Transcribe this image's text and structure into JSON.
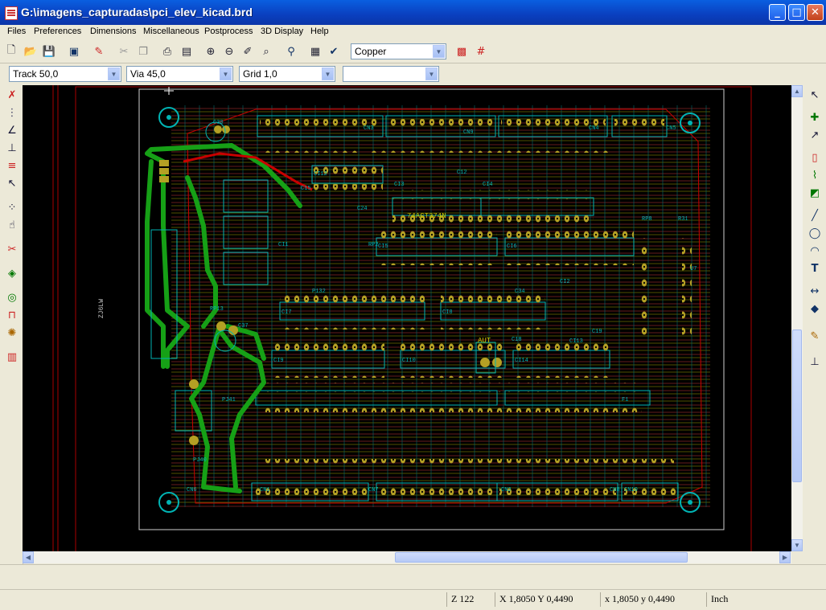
{
  "window": {
    "title": "G:\\imagens_capturadas\\pci_elev_kicad.brd",
    "min_label": "_",
    "max_label": "□",
    "close_label": "✕"
  },
  "menu": [
    "Files",
    "Preferences",
    "Dimensions",
    "Miscellaneous",
    "Postprocess",
    "3D Display",
    "Help"
  ],
  "toolbar": {
    "layer_select": "Copper",
    "track_select": "Track 50,0",
    "via_select": "Via 45,0",
    "grid_select": "Grid 1,0",
    "zoom_select": ""
  },
  "board": {
    "ic_label": "74ACT374N",
    "connector_label": "AUT",
    "side_label": "ZJ6LW",
    "refs": [
      "C30",
      "C37",
      "C15",
      "C12",
      "C19",
      "C18",
      "CN9",
      "CN8",
      "CN7",
      "CN6",
      "CN5",
      "CN4",
      "CN3",
      "CN2",
      "CN1",
      "CN10",
      "CI1",
      "CI3",
      "CI4",
      "CI5",
      "CI6",
      "CI7",
      "CI8",
      "CI9",
      "CI10",
      "CI12",
      "CI13",
      "CI14",
      "F1",
      "PJ41",
      "PJ40",
      "RP13",
      "RP8",
      "RP2",
      "P132",
      "R31",
      "U7",
      "CI2",
      "C34",
      "C24"
    ]
  },
  "status": {
    "zoom": "Z 122",
    "abs_coord": "X 1,8050  Y 0,4490",
    "rel_coord": "x 1,8050  y 0,4490",
    "units": "Inch"
  },
  "colors": {
    "background": "#000000",
    "copper": "#c8c800",
    "silk": "#00b4b4",
    "edge": "#c80000",
    "tracks": "#16a016",
    "pads": "#b4a024"
  }
}
